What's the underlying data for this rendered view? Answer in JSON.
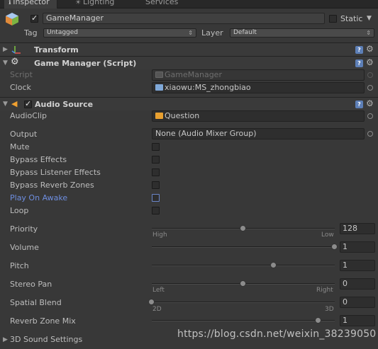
{
  "tabs": [
    {
      "label": "Inspector",
      "active": true
    },
    {
      "label": "Lighting",
      "active": false
    },
    {
      "label": "Services",
      "active": false
    }
  ],
  "gameobject": {
    "active": true,
    "name": "GameManager",
    "static_label": "Static",
    "tag_label": "Tag",
    "tag_value": "Untagged",
    "layer_label": "Layer",
    "layer_value": "Default"
  },
  "transform": {
    "title": "Transform"
  },
  "script_component": {
    "title": "Game Manager (Script)",
    "script_label": "Script",
    "script_value": "GameManager",
    "clock_label": "Clock",
    "clock_value": "xiaowu:MS_zhongbiao"
  },
  "audio_source": {
    "title": "Audio Source",
    "enabled": true,
    "audioclip_label": "AudioClip",
    "audioclip_value": "Question",
    "output_label": "Output",
    "output_value": "None (Audio Mixer Group)",
    "toggles": [
      {
        "label": "Mute",
        "checked": false
      },
      {
        "label": "Bypass Effects",
        "checked": false
      },
      {
        "label": "Bypass Listener Effects",
        "checked": false
      },
      {
        "label": "Bypass Reverb Zones",
        "checked": false
      },
      {
        "label": "Play On Awake",
        "checked": false,
        "highlighted": true
      },
      {
        "label": "Loop",
        "checked": false
      }
    ],
    "sliders": {
      "priority": {
        "label": "Priority",
        "value": "128",
        "fraction": 0.5,
        "left_caption": "High",
        "right_caption": "Low"
      },
      "volume": {
        "label": "Volume",
        "value": "1",
        "fraction": 1.0
      },
      "pitch": {
        "label": "Pitch",
        "value": "1",
        "fraction": 0.667
      },
      "stereo_pan": {
        "label": "Stereo Pan",
        "value": "0",
        "fraction": 0.5,
        "left_caption": "Left",
        "right_caption": "Right"
      },
      "spatial_blend": {
        "label": "Spatial Blend",
        "value": "0",
        "fraction": 0.0,
        "left_caption": "2D",
        "right_caption": "3D"
      },
      "reverb_zone_mix": {
        "label": "Reverb Zone Mix",
        "value": "1",
        "fraction": 0.909
      }
    },
    "sound_settings_label": "3D Sound Settings"
  },
  "watermark": "https://blog.csdn.net/weixin_38239050",
  "colors": {
    "accent": "#5d7fb7",
    "highlight_label": "#6e8ee0",
    "background": "#383838"
  }
}
